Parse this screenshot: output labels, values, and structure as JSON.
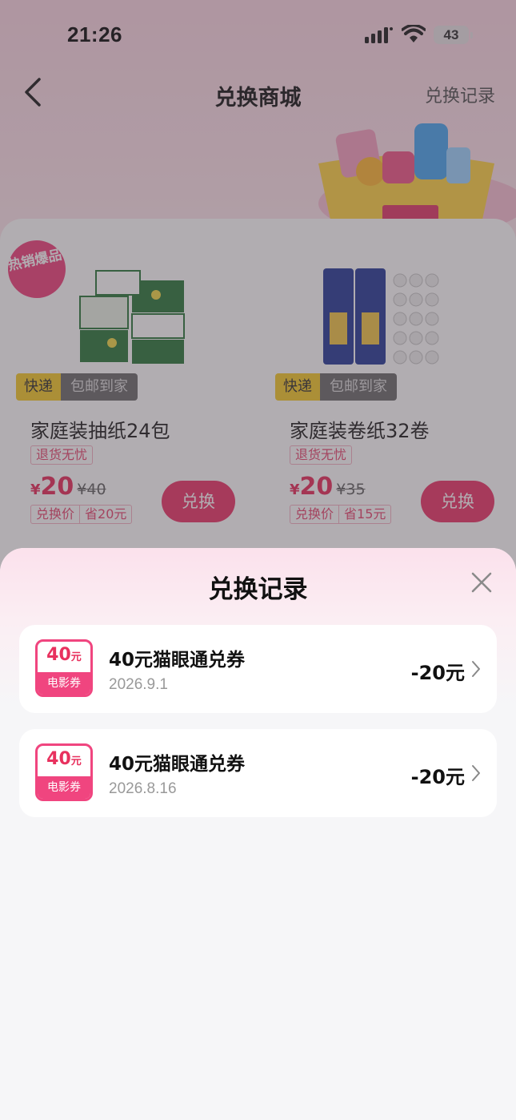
{
  "status_bar": {
    "time": "21:26",
    "battery": "43"
  },
  "nav": {
    "title": "兑换商城",
    "record_link": "兑换记录"
  },
  "products": [
    {
      "badge": "热销爆品",
      "ship_tag": "快递",
      "ship_note": "包邮到家",
      "name": "家庭装抽纸24包",
      "return_tag": "退货无忧",
      "currency": "¥",
      "price": "20",
      "original_price": "¥40",
      "price_label": "兑换价",
      "save_text": "省20元",
      "button": "兑换"
    },
    {
      "ship_tag": "快递",
      "ship_note": "包邮到家",
      "name": "家庭装卷纸32卷",
      "return_tag": "退货无忧",
      "currency": "¥",
      "price": "20",
      "original_price": "¥35",
      "price_label": "兑换价",
      "save_text": "省15元",
      "button": "兑换"
    }
  ],
  "sheet": {
    "title": "兑换记录",
    "records": [
      {
        "coupon_amount": "40",
        "coupon_unit": "元",
        "coupon_type": "电影券",
        "name": "40元猫眼通兑券",
        "date": "2026.9.1",
        "amount": "-20元"
      },
      {
        "coupon_amount": "40",
        "coupon_unit": "元",
        "coupon_type": "电影券",
        "name": "40元猫眼通兑券",
        "date": "2026.8.16",
        "amount": "-20元"
      }
    ]
  },
  "colors": {
    "accent": "#ec3a6b",
    "coupon_pink": "#f0457f",
    "ship_yellow": "#f5cc2e"
  },
  "icons": [
    "back-icon",
    "signal-icon",
    "wifi-icon",
    "battery-icon",
    "close-icon",
    "chevron-right-icon"
  ]
}
